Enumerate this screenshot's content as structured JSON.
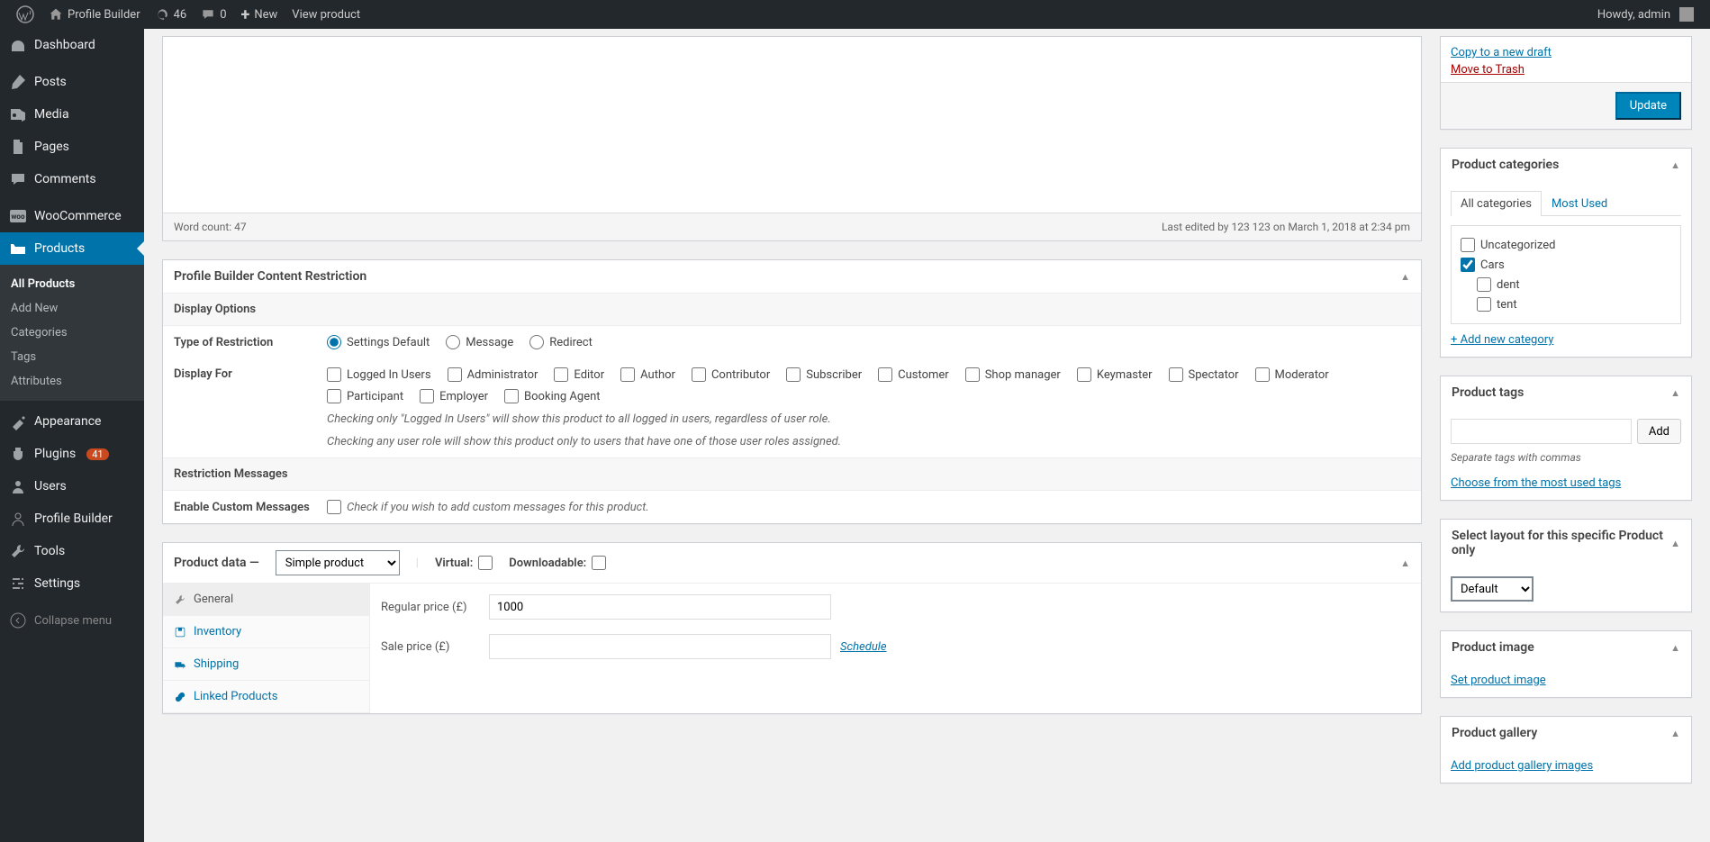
{
  "adminbar": {
    "site_name": "Profile Builder",
    "updates": "46",
    "comments": "0",
    "new": "New",
    "view": "View product",
    "howdy": "Howdy, admin"
  },
  "sidebar": {
    "dashboard": "Dashboard",
    "posts": "Posts",
    "media": "Media",
    "pages": "Pages",
    "comments": "Comments",
    "woocommerce": "WooCommerce",
    "products": "Products",
    "all_products": "All Products",
    "add_new": "Add New",
    "categories": "Categories",
    "tags": "Tags",
    "attributes": "Attributes",
    "appearance": "Appearance",
    "plugins": "Plugins",
    "plugins_badge": "41",
    "users": "Users",
    "profile_builder": "Profile Builder",
    "tools": "Tools",
    "settings": "Settings",
    "collapse": "Collapse menu"
  },
  "editor": {
    "word_count": "Word count: 47",
    "last_edited": "Last edited by 123 123 on March 1, 2018 at 2:34 pm"
  },
  "restriction": {
    "title": "Profile Builder Content Restriction",
    "display_options": "Display Options",
    "type_label": "Type of Restriction",
    "type_settings": "Settings Default",
    "type_message": "Message",
    "type_redirect": "Redirect",
    "display_for": "Display For",
    "roles": {
      "logged_in": "Logged In Users",
      "administrator": "Administrator",
      "editor": "Editor",
      "author": "Author",
      "contributor": "Contributor",
      "subscriber": "Subscriber",
      "customer": "Customer",
      "shop_manager": "Shop manager",
      "keymaster": "Keymaster",
      "spectator": "Spectator",
      "moderator": "Moderator",
      "participant": "Participant",
      "employer": "Employer",
      "booking_agent": "Booking Agent"
    },
    "hint1": "Checking only \"Logged In Users\" will show this product to all logged in users, regardless of user role.",
    "hint2": "Checking any user role will show this product only to users that have one of those user roles assigned.",
    "restriction_messages": "Restriction Messages",
    "enable_custom": "Enable Custom Messages",
    "enable_hint": "Check if you wish to add custom messages for this product."
  },
  "product_data": {
    "title": "Product data —",
    "type": "Simple product",
    "virtual": "Virtual:",
    "downloadable": "Downloadable:",
    "tabs": {
      "general": "General",
      "inventory": "Inventory",
      "shipping": "Shipping",
      "linked": "Linked Products"
    },
    "regular_price": "Regular price (£)",
    "regular_price_val": "1000",
    "sale_price": "Sale price (£)",
    "schedule": "Schedule"
  },
  "publish": {
    "copy": "Copy to a new draft",
    "trash": "Move to Trash",
    "update": "Update"
  },
  "categories": {
    "title": "Product categories",
    "tab_all": "All categories",
    "tab_most": "Most Used",
    "uncategorized": "Uncategorized",
    "cars": "Cars",
    "dent": "dent",
    "tent": "tent",
    "add_new": "+ Add new category"
  },
  "tags": {
    "title": "Product tags",
    "add": "Add",
    "sep": "Separate tags with commas",
    "choose": "Choose from the most used tags"
  },
  "layout": {
    "title": "Select layout for this specific Product only",
    "default": "Default"
  },
  "image": {
    "title": "Product image",
    "set": "Set product image"
  },
  "gallery": {
    "title": "Product gallery",
    "add": "Add product gallery images"
  }
}
